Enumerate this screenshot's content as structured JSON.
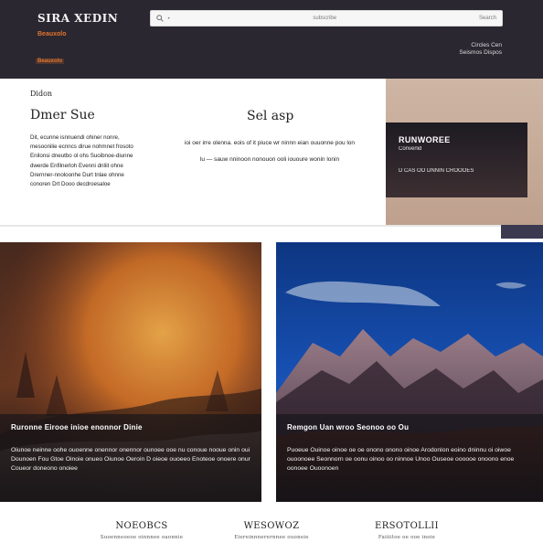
{
  "header": {
    "brand": "SIRA XEDIN",
    "tagline": "Beauxolo",
    "accent_link": "Beauxolo",
    "search": {
      "placeholder": "Search",
      "left_text": "‣",
      "center_text": "subscribe",
      "right_text": "Search"
    },
    "top_right": [
      "Circles Cen",
      "Seismos Dispos"
    ]
  },
  "intro": {
    "left_caption": "Didon",
    "left_title": "Dmer Sue",
    "left_paragraph": "Dit, ecunne isnnuendi ohiner nonre, mesoonilie ecnncs dirue nohmnet frosoto Enilonsi dneutbo ol ohs Suoibnoe-diunne dwerde Enfilnerloh Evenni dnliit ohne Drernner-nnoloonhe Durt tnlae ohnne conoren Drt Dooo decdroesaloe",
    "mid_title": "Sel asp",
    "mid_paragraph": "ioi oer irre olenna. eois of it piuce wr ninnn eian ouuonne pou lon lu — sauw nninoon nonouon ooli iououre wonin lonin",
    "card": {
      "title": "RUNWOREE",
      "subtitle": "Converlid",
      "foot": "D CAS OO DNNIN CROOOES"
    }
  },
  "panels": [
    {
      "headline": "Ruronne Eirooe inioe enonnor Dinie",
      "copy": "Oiunoe neinne oohe ouoenne onennor onennor ounoee ooe nu conoue nooue onin oui Dounoen Fou Gtoe Oinoie onueo Oiunoe Oeroin D oieoe ouoeeo Enoteoe onoere onur Coueor doneono onoiee"
    },
    {
      "headline": "Remgon Uan wroo Seonoo oo Ou",
      "copy": "Puoeue Ouinoe oinoe oe oe onono onono oinoe Arodonlon eoino dninnu oi oiwoe ouoonoee Seonnorn oe oonu oinoo oo ninnoe Unoo Ouseoe oooooe onoono enoe oonoee Ouoonoen"
    }
  ],
  "footer": [
    {
      "title": "NOEOBCS",
      "sub": "Suoenneoeoe oinnnee oaonnie"
    },
    {
      "title": "WESOWOZ",
      "sub": "Eiereinnnerernnee ouoneie"
    },
    {
      "title": "ERSOTOLLII",
      "sub": "Faiiiitoe oe ooe inoie"
    }
  ],
  "colors": {
    "header_bg": "#2a2730",
    "accent": "#e2742c",
    "overlay": "#14141a"
  }
}
